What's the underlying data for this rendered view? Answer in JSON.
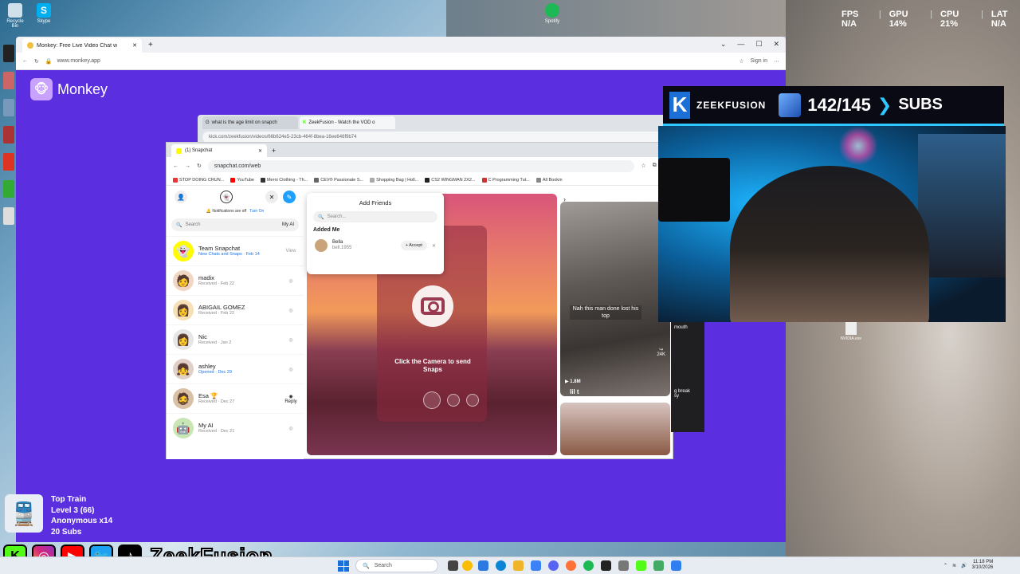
{
  "desktop": {
    "icons": [
      {
        "name": "Recycle Bin"
      },
      {
        "name": "Skype"
      },
      {
        "name": "Spotify"
      }
    ]
  },
  "stats": {
    "fps_label": "FPS",
    "fps": "N/A",
    "gpu_label": "GPU",
    "gpu": "14",
    "cpu_label": "CPU",
    "cpu": "21",
    "lat_label": "LAT",
    "lat": "N/A",
    "pct": "%",
    "sep": "|"
  },
  "browser_main": {
    "tab_title": "Monkey: Free Live Video Chat w",
    "url": "www.monkey.app",
    "sign_in": "Sign in",
    "app_name": "Monkey"
  },
  "browser_kick": {
    "tabs": [
      "what is the age limit on snapch",
      "ZeekFusion - Watch the VOD o"
    ],
    "url": "kick.com/zeekfusion/videos/66b624e5-23cb-464f-8bea-16ee646f9b74"
  },
  "snapchat": {
    "tab_title": "(1) Snapchat",
    "url": "snapchat.com/web",
    "bookmarks": [
      "STOP DOING CRUN...",
      "YouTube",
      "Merni Clothing - Th...",
      "CEV® Passionate S...",
      "Shopping Bag | Holl...",
      "CS2 WINGMAN 2X2...",
      "C Programming Tut...",
      "All Bookm"
    ],
    "notif_text": "Notifications are off",
    "notif_link": "Turn On",
    "search_placeholder": "Search",
    "my_ai": "My AI",
    "chats": [
      {
        "name": "Team Snapchat",
        "status": "New Chats and Snaps",
        "date": "Feb 14",
        "action": "View"
      },
      {
        "name": "madix",
        "status": "Received",
        "date": "Feb 22",
        "action": ""
      },
      {
        "name": "ABIGAIL GOMEZ",
        "status": "Received",
        "date": "Feb 22",
        "action": ""
      },
      {
        "name": "Nic",
        "status": "Received",
        "date": "Jan 2",
        "action": ""
      },
      {
        "name": "ashley",
        "status": "Opened",
        "date": "Dec 29",
        "action": ""
      },
      {
        "name": "Esa 🏆",
        "status": "Received",
        "date": "Dec 27",
        "action": "Reply"
      },
      {
        "name": "My AI",
        "status": "Received",
        "date": "Dec 21",
        "action": ""
      }
    ],
    "add_friends": {
      "title": "Add Friends",
      "search_placeholder": "Search...",
      "section": "Added Me",
      "friend_name": "Bella",
      "friend_user": "bell.1955",
      "accept": "Accept"
    },
    "camera_text": "Click the Camera to send Snaps"
  },
  "tiktok": {
    "caption": "Nah this man done lost his top",
    "share_count": "24K",
    "views": "1.8M",
    "username": "lil t",
    "side_text_1": "mouth",
    "side_text_2": "g break",
    "side_text_3": "sy"
  },
  "sub_goal": {
    "name": "ZEEKFUSION",
    "count": "142/145",
    "label": "SUBS"
  },
  "desktop_file": "NVIDIA.exe",
  "train": {
    "title": "Top Train",
    "level": "Level 3  (66)",
    "top": "Anonymous x14",
    "subs": "20 Subs"
  },
  "socials": {
    "handle": "ZeekFusion"
  },
  "taskbar": {
    "search": "Search",
    "time": "11:18 PM",
    "date": "3/10/2026"
  }
}
